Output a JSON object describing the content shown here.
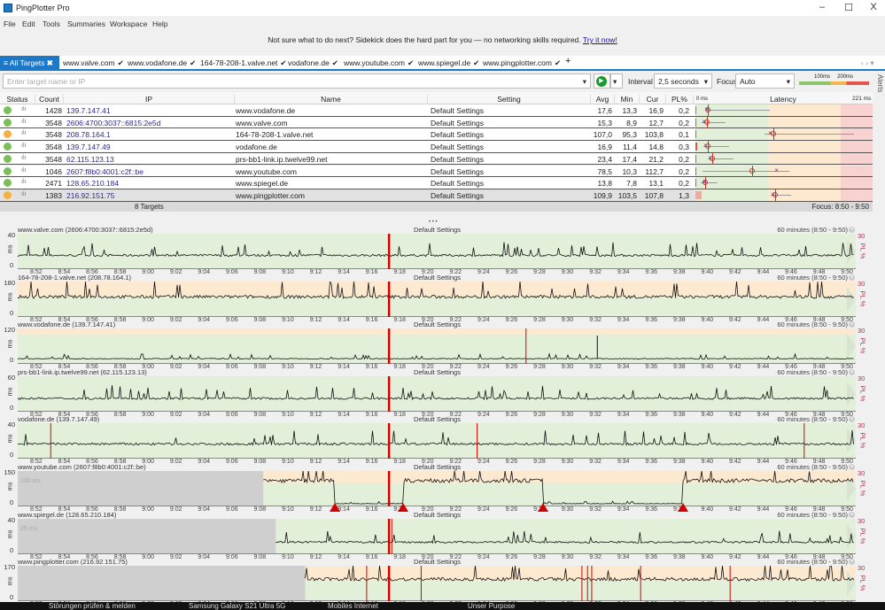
{
  "app": {
    "title": "PingPlotter Pro",
    "minimize": "–",
    "maximize": "☐",
    "close": "X"
  },
  "menu": [
    "File",
    "Edit",
    "Tools",
    "Summaries",
    "Workspace",
    "Help"
  ],
  "banner": {
    "text": "Not sure what to do next? Sidekick does the hard part for you — no networking skills required.",
    "link": "Try it now!"
  },
  "tabs": {
    "all_label": "All Targets",
    "items": [
      "www.valve.com",
      "www.vodafone.de",
      "164-78-208-1.valve.net",
      "vodafone.de",
      "www.youtube.com",
      "www.spiegel.de",
      "www.pingplotter.com"
    ],
    "check": "✔",
    "add": "+",
    "nav": "‹ › ▾"
  },
  "filter": {
    "placeholder": "Enter target name or IP",
    "interval_label": "Interval",
    "interval_value": "2,5 seconds",
    "focus_label": "Focus",
    "focus_value": "Auto",
    "legend_100": "100ms",
    "legend_200": "200ms",
    "alerts": "Alerts"
  },
  "colors": {
    "accent": "#1e78c8",
    "good": "#7cbf5a",
    "warn": "#f5b041",
    "bad": "#e05a4a",
    "band_green": "#e2f0d9",
    "band_orange": "#fde9cf",
    "band_red": "#f8d2d0",
    "loss": "#d00000"
  },
  "table": {
    "headers": [
      "Status",
      "Count",
      "IP",
      "Name",
      "Setting",
      "Avg",
      "Min",
      "Cur",
      "PL%",
      "Latency"
    ],
    "scale_min": "0 ms",
    "scale_max": "221 ms",
    "scale_max_ms": 221,
    "rows": [
      {
        "status": "good",
        "count": "1428",
        "ip": "139.7.147.41",
        "name": "www.vodafone.de",
        "setting": "Default Settings",
        "avg": "17,6",
        "min": "13,3",
        "cur": "16,9",
        "pl": "0,2",
        "max_ms": 103
      },
      {
        "status": "good",
        "count": "3548",
        "ip": "2606:4700:3037::6815:2e5d",
        "name": "www.valve.com",
        "setting": "Default Settings",
        "avg": "15,3",
        "min": "8,9",
        "cur": "12,7",
        "pl": "0,2",
        "max_ms": 41
      },
      {
        "status": "warn",
        "count": "3548",
        "ip": "208.78.164.1",
        "name": "164-78-208-1.valve.net",
        "setting": "Default Settings",
        "avg": "107,0",
        "min": "95,3",
        "cur": "103,8",
        "pl": "0,1",
        "max_ms": 218
      },
      {
        "status": "good",
        "count": "3548",
        "ip": "139.7.147.49",
        "name": "vodafone.de",
        "setting": "Default Settings",
        "avg": "16,9",
        "min": "11,4",
        "cur": "14,8",
        "pl": "0,3",
        "max_ms": 47
      },
      {
        "status": "good",
        "count": "3548",
        "ip": "62.115.123.13",
        "name": "prs-bb1-link.ip.twelve99.net",
        "setting": "Default Settings",
        "avg": "23,4",
        "min": "17,4",
        "cur": "21,2",
        "pl": "0,2",
        "max_ms": 52
      },
      {
        "status": "good",
        "count": "1046",
        "ip": "2607:f8b0:4001:c2f::be",
        "name": "www.youtube.com",
        "setting": "Default Settings",
        "avg": "78,5",
        "min": "10,3",
        "cur": "112,7",
        "pl": "0,2",
        "max_ms": 129
      },
      {
        "status": "good",
        "count": "2471",
        "ip": "128.65.210.184",
        "name": "www.spiegel.de",
        "setting": "Default Settings",
        "avg": "13,8",
        "min": "7,8",
        "cur": "13,1",
        "pl": "0,2",
        "max_ms": 30
      },
      {
        "status": "warn",
        "count": "1383",
        "ip": "216.92.151.75",
        "name": "www.pingplotter.com",
        "setting": "Default Settings",
        "avg": "109,9",
        "min": "103,5",
        "cur": "107,8",
        "pl": "1,3",
        "max_ms": 132
      }
    ],
    "footer_count": "8 Targets",
    "footer_focus": "Focus: 8:50 - 9:50"
  },
  "graphs": {
    "divider": "• • •",
    "time_ticks": [
      "8:52",
      "8:54",
      "8:56",
      "8:58",
      "9:00",
      "9:02",
      "9:04",
      "9:06",
      "9:08",
      "9:10",
      "9:12",
      "9:14",
      "9:16",
      "9:18",
      "9:20",
      "9:22",
      "9:24",
      "9:26",
      "9:28",
      "9:30",
      "9:32",
      "9:34",
      "9:36",
      "9:38",
      "9:40",
      "9:42",
      "9:44",
      "9:46",
      "9:48",
      "9:50"
    ],
    "y_unit": "ms",
    "y_zero": "0",
    "pl_max": "30",
    "pl_label": "PL %",
    "panels": [
      {
        "title": "www.valve.com (2606:4700:3037::6815:2e5d)",
        "setting": "Default Settings",
        "range": "60 minutes (8:50 - 9:50)",
        "ymax": "40",
        "avg_ms": 16,
        "data_start": "8:50",
        "loss": [
          "9:17.1"
        ],
        "spikes": []
      },
      {
        "title": "164-78-208-1.valve.net (208.78.164.1)",
        "setting": "Default Settings",
        "range": "60 minutes (8:50 - 9:50)",
        "ymax": "180",
        "avg_ms": 105,
        "data_start": "8:50",
        "loss": [
          "9:17.1"
        ],
        "spikes": []
      },
      {
        "title": "www.vodafone.de (139.7.147.41)",
        "setting": "Default Settings",
        "range": "60 minutes (8:50 - 9:50)",
        "ymax": "120",
        "avg_ms": 18,
        "data_start": "8:50",
        "loss": [
          "9:17.1",
          "9:26.9"
        ],
        "spikes": [
          "9:32.0"
        ]
      },
      {
        "title": "prs-bb1-link.ip.twelve99.net (62.115.123.13)",
        "setting": "Default Settings",
        "range": "60 minutes (8:50 - 9:50)",
        "ymax": "60",
        "avg_ms": 23,
        "data_start": "8:50",
        "loss": [
          "9:17.1"
        ],
        "spikes": []
      },
      {
        "title": "vodafone.de (139.7.147.49)",
        "setting": "Default Settings",
        "range": "60 minutes (8:50 - 9:50)",
        "ymax": "40",
        "avg_ms": 17,
        "data_start": "8:50",
        "loss": [
          "8:52.9",
          "9:17.1",
          "9:23.4",
          "9:46.8"
        ],
        "spikes": []
      },
      {
        "title": "www.youtube.com (2607:f8b0:4001:c2f::be)",
        "setting": "Default Settings",
        "range": "60 minutes (8:50 - 9:50)",
        "ymax": "150",
        "gray_label": "100 ms",
        "data_start": "9:08.1",
        "steps": [
          [
            "9:08.1",
            112
          ],
          [
            "9:13.2",
            12
          ],
          [
            "9:18.1",
            112
          ],
          [
            "9:28.1",
            12
          ],
          [
            "9:38.1",
            112
          ]
        ],
        "loss": [
          "9:17.1"
        ],
        "route_changes": [
          "9:13.2",
          "9:18.1",
          "9:28.1",
          "9:38.1"
        ],
        "spikes": []
      },
      {
        "title": "www.spiegel.de (128.65.210.184)",
        "setting": "Default Settings",
        "range": "60 minutes (8:50 - 9:50)",
        "ymax": "40",
        "gray_label": "25 ms",
        "avg_ms": 14,
        "data_start": "9:09.0",
        "loss": [
          "9:17.1",
          "9:17.3"
        ],
        "spikes": []
      },
      {
        "title": "www.pingplotter.com (216.92.151.75)",
        "setting": "Default Settings",
        "range": "60 minutes (8:50 - 9:50)",
        "ymax": "170",
        "avg_ms": 108,
        "data_start": "9:11.1",
        "loss": [
          "9:15.5",
          "9:17.1",
          "9:19.4",
          "9:30.9",
          "9:31.3",
          "9:31.6",
          "9:35.1",
          "9:41.5"
        ],
        "spikes": []
      }
    ]
  },
  "taskbar": [
    "Störungen prüfen & melden",
    "Samsung Galaxy S21 Ultra 5G",
    "Mobiles Internet",
    "Unser Purpose"
  ]
}
